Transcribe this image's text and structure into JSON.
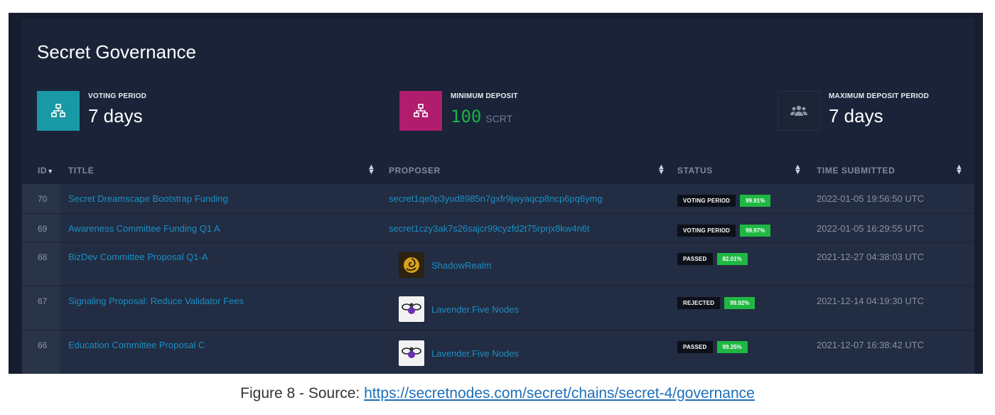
{
  "page": {
    "title": "Secret Governance"
  },
  "stats": [
    {
      "label": "VOTING PERIOD",
      "value": "7 days",
      "icon": "network-icon",
      "color": "#1999a5"
    },
    {
      "label": "MINIMUM DEPOSIT",
      "value": "100",
      "unit": "SCRT",
      "icon": "network-icon",
      "color": "#b01d6d"
    },
    {
      "label": "MAXIMUM DEPOSIT PERIOD",
      "value": "7 days",
      "icon": "users-icon",
      "color": "#1c2436"
    }
  ],
  "table": {
    "columns": {
      "id": "ID",
      "title": "TITLE",
      "proposer": "PROPOSER",
      "status": "STATUS",
      "time": "TIME SUBMITTED"
    },
    "rows": [
      {
        "id": "70",
        "title": "Secret Dreamscape Bootstrap Funding",
        "proposer": "secret1qe0p3yud8985n7gxfr9jwyaqcp8ncp6pq6ymg",
        "status": "VOTING PERIOD",
        "pct": "99.91%",
        "time": "2022-01-05 19:56:50 UTC"
      },
      {
        "id": "69",
        "title": "Awareness Committee Funding Q1 A",
        "proposer": "secret1czy3ak7s26sajcr99cyzfd2t75rprjx8kw4n6t",
        "status": "VOTING PERIOD",
        "pct": "99.97%",
        "time": "2022-01-05 16:29:55 UTC"
      },
      {
        "id": "68",
        "title": "BizDev Committee Proposal Q1-A",
        "proposer": "ShadowRealm",
        "status": "PASSED",
        "pct": "82.01%",
        "time": "2021-12-27 04:38:03 UTC"
      },
      {
        "id": "67",
        "title": "Signaling Proposal: Reduce Validator Fees",
        "proposer": "Lavender.Five Nodes",
        "status": "REJECTED",
        "pct": "99.92%",
        "time": "2021-12-14 04:19:30 UTC"
      },
      {
        "id": "66",
        "title": "Education Committee Proposal C",
        "proposer": "Lavender.Five Nodes",
        "status": "PASSED",
        "pct": "99.35%",
        "time": "2021-12-07 16:38:42 UTC"
      }
    ]
  },
  "caption": {
    "prefix": "Figure 8 - Source: ",
    "link": "https://secretnodes.com/secret/chains/secret-4/governance"
  },
  "colors": {
    "link": "#1a8fc4",
    "green": "#1fb843",
    "bg": "#1a2338"
  }
}
